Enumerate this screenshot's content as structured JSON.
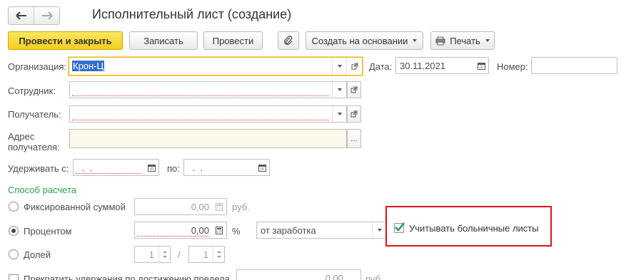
{
  "window": {
    "title": "Исполнительный лист (создание)"
  },
  "toolbar": {
    "post_close": "Провести и закрыть",
    "save": "Записать",
    "post": "Провести",
    "create_based": "Создать на основании",
    "print": "Печать"
  },
  "form": {
    "organization": {
      "label": "Организация:",
      "value": "Крон-Ц"
    },
    "date": {
      "label": "Дата:",
      "value": "30.11.2021"
    },
    "number": {
      "label": "Номер:",
      "value": ""
    },
    "employee": {
      "label": "Сотрудник:",
      "value": ""
    },
    "recipient": {
      "label": "Получатель:",
      "value": ""
    },
    "recipient_address": {
      "label_line1": "Адрес",
      "label_line2": "получателя:",
      "value": "",
      "button": "..."
    },
    "withhold_from": {
      "label": "Удерживать с:",
      "value": " .  .  "
    },
    "withhold_to": {
      "label": "по:",
      "value": " .  .  "
    }
  },
  "calc": {
    "section_title": "Способ расчета",
    "fixed": {
      "label": "Фиксированной суммой",
      "value": "0,00",
      "unit": "руб."
    },
    "percent": {
      "label": "Процентом",
      "value": "0,00",
      "unit": "%",
      "base": "от заработка"
    },
    "share": {
      "label": "Долей",
      "numerator": "1",
      "separator": "/",
      "denominator": "1"
    },
    "sick_leave": {
      "label": "Учитывать больничные листы",
      "checked": true
    },
    "stop_limit": {
      "label": "Прекратить удержания по достижению предела",
      "value": "0,00",
      "unit": "руб."
    }
  },
  "colors": {
    "accent": "#f4cf1e",
    "section": "#2ba14a",
    "highlight": "#d9151c",
    "check": "#2ba14a"
  }
}
